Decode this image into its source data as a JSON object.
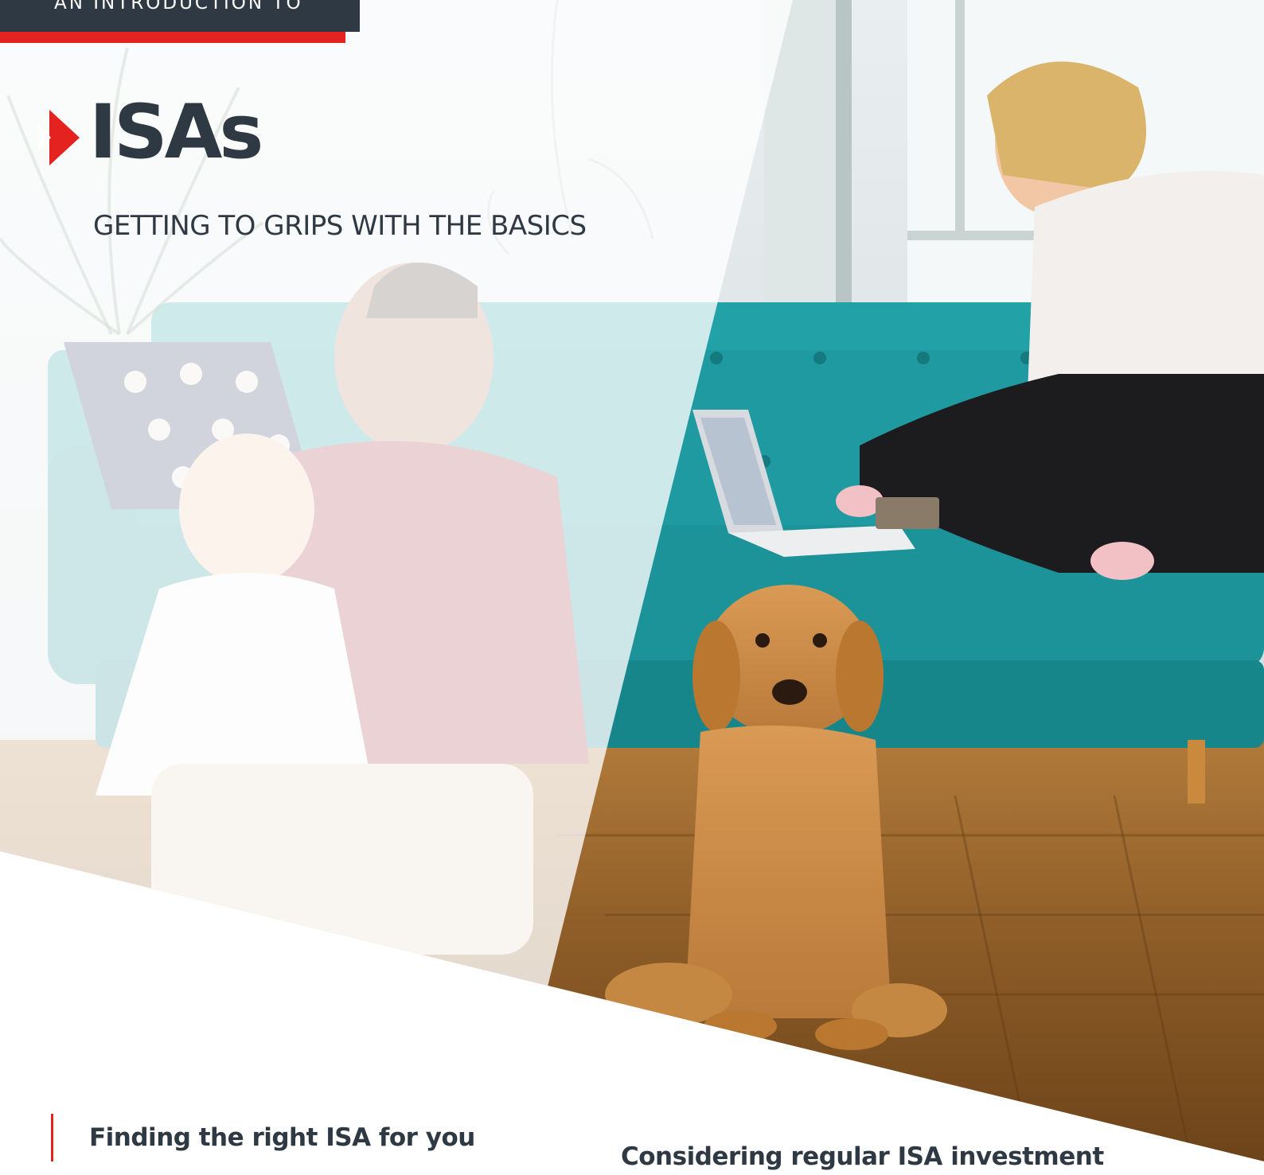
{
  "banner": {
    "label": "AN INTRODUCTION TO"
  },
  "header": {
    "title": "ISAs",
    "subtitle": "GETTING TO GRIPS WITH THE BASICS"
  },
  "sections": [
    {
      "heading": "Finding the right ISA for you"
    },
    {
      "heading": "Considering regular ISA investment"
    }
  ],
  "colors": {
    "accent": "#e42320",
    "navy": "#2f3943",
    "sofa": "#1f9aa0",
    "floor": "#8a5a26"
  }
}
